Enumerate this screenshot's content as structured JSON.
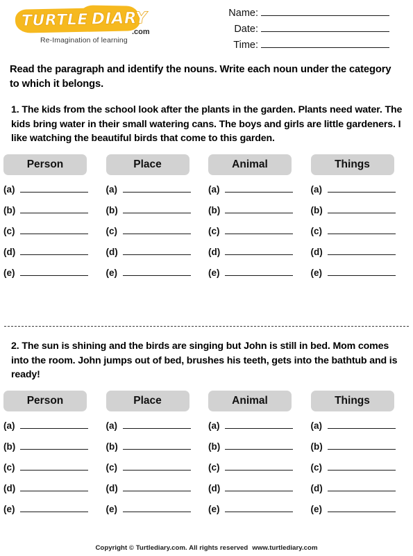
{
  "logo": {
    "word1": "TURTLE",
    "word2": "DIARY",
    "dotcom": ".com",
    "tagline": "Re-Imagination of learning",
    "brand_color": "#f6b91f",
    "text_color": "#ffffff"
  },
  "header_fields": [
    {
      "label": "Name:"
    },
    {
      "label": "Date:"
    },
    {
      "label": "Time:"
    }
  ],
  "instruction": "Read the paragraph and identify the nouns. Write each noun under the category to which it belongs.",
  "categories": [
    "Person",
    "Place",
    "Animal",
    "Things"
  ],
  "answer_labels": [
    "(a)",
    "(b)",
    "(c)",
    "(d)",
    "(e)"
  ],
  "sections": [
    {
      "number": "1.",
      "paragraph": "1. The kids from the school look after the plants in the garden. Plants need water. The kids bring water in their small watering cans. The boys and girls are little gardeners. I like watching the beautiful birds that come to this garden."
    },
    {
      "number": "2.",
      "paragraph": "2. The sun is shining and the birds are singing but John is still in bed. Mom comes into the room. John jumps out of bed, brushes his teeth, gets into the bathtub and is ready!"
    }
  ],
  "footer": {
    "copyright": "Copyright © Turtlediary.com. All rights reserved",
    "website": "www.turtlediary.com"
  },
  "colors": {
    "category_box": "#d2d2d2",
    "rule": "#1a1a1a"
  }
}
